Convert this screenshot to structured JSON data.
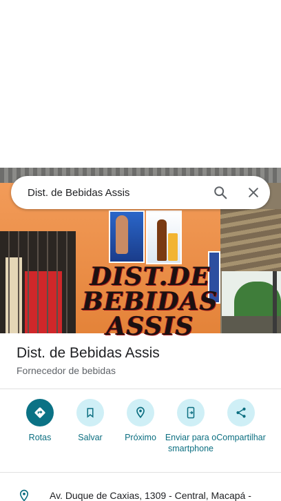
{
  "search": {
    "query": "Dist. de Bebidas Assis",
    "icons": [
      "search-icon",
      "close-icon"
    ]
  },
  "photo": {
    "sign_lines": [
      "DIST.DE",
      "BEBIDAS",
      "ASSIS"
    ]
  },
  "place": {
    "title": "Dist. de Bebidas Assis",
    "category": "Fornecedor de bebidas"
  },
  "actions": [
    {
      "label": "Rotas",
      "icon": "directions-icon"
    },
    {
      "label": "Salvar",
      "icon": "bookmark-icon"
    },
    {
      "label": "Próximo",
      "icon": "nearby-icon"
    },
    {
      "label": "Enviar para o smartphone",
      "icon": "send-to-phone-icon"
    },
    {
      "label": "Compartilhar",
      "icon": "share-icon"
    }
  ],
  "address": {
    "text": "Av. Duque de Caxias, 1309 - Central, Macapá -",
    "icon": "location-pin-icon"
  },
  "colors": {
    "accent": "#0b7285",
    "accent_light": "#cfeff6",
    "label": "#0b6e80"
  }
}
